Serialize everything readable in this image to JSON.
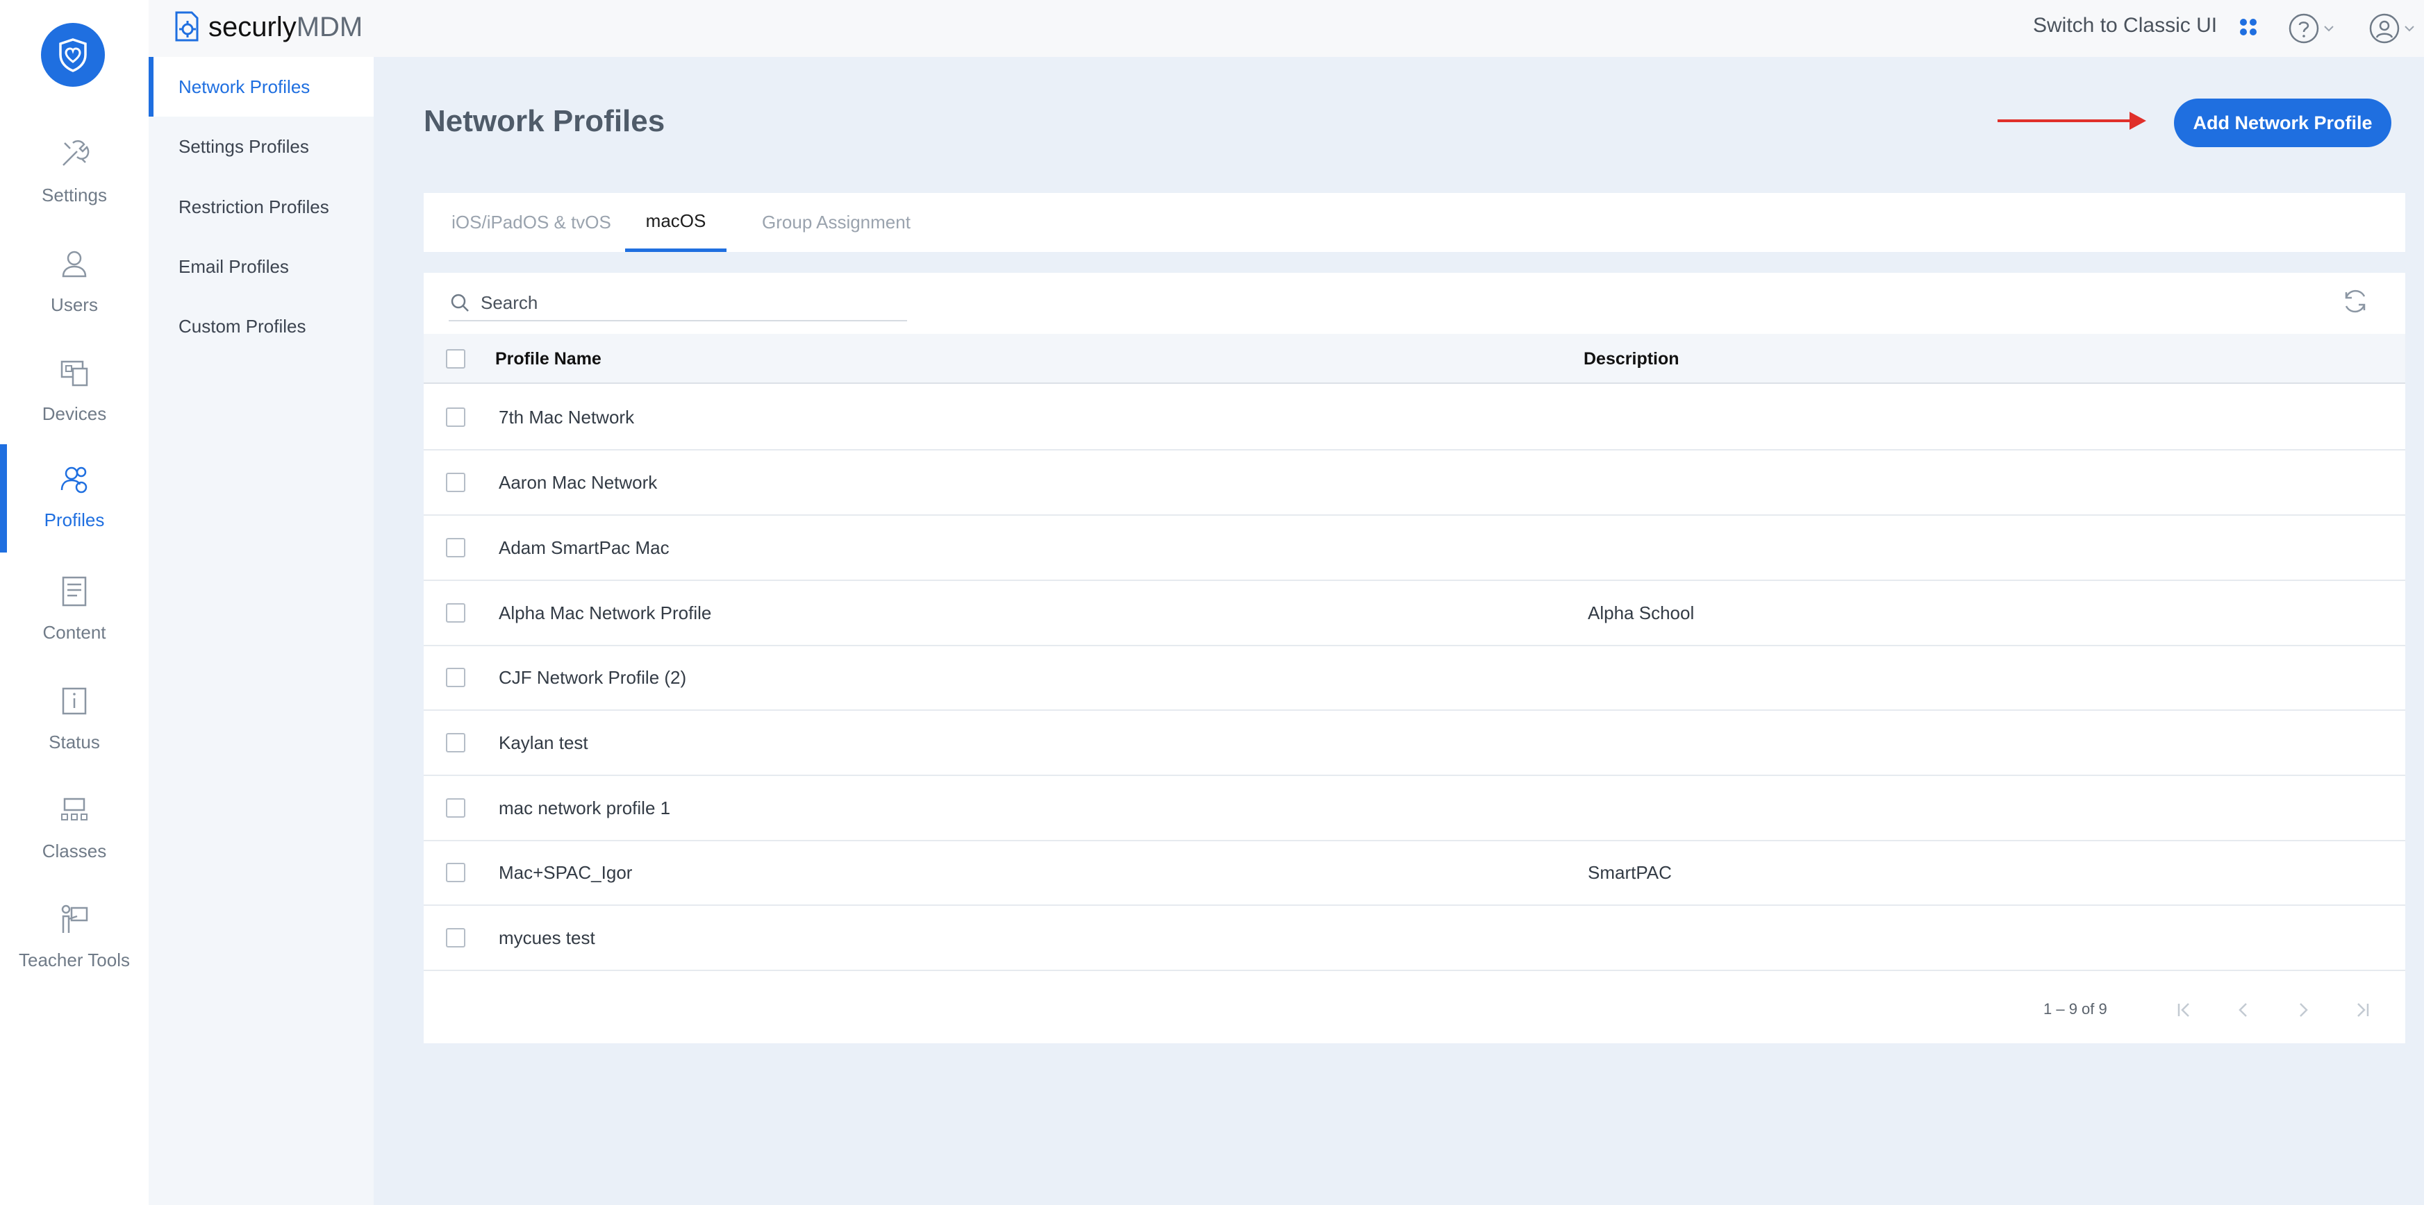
{
  "app": {
    "brand_prefix": "securly",
    "brand_suffix": "MDM"
  },
  "topbar": {
    "switch_classic": "Switch to Classic UI"
  },
  "rail": {
    "items": [
      {
        "label": "Settings",
        "icon": "settings-tools-icon"
      },
      {
        "label": "Users",
        "icon": "user-icon"
      },
      {
        "label": "Devices",
        "icon": "devices-icon"
      },
      {
        "label": "Profiles",
        "icon": "profiles-icon",
        "active": true
      },
      {
        "label": "Content",
        "icon": "content-icon"
      },
      {
        "label": "Status",
        "icon": "status-icon"
      },
      {
        "label": "Classes",
        "icon": "classes-icon"
      },
      {
        "label": "Teacher Tools",
        "icon": "teacher-tools-icon"
      }
    ]
  },
  "subnav": {
    "items": [
      {
        "label": "Network Profiles",
        "active": true
      },
      {
        "label": "Settings Profiles"
      },
      {
        "label": "Restriction Profiles"
      },
      {
        "label": "Email Profiles"
      },
      {
        "label": "Custom Profiles"
      }
    ]
  },
  "main": {
    "title": "Network Profiles",
    "add_button": "Add Network Profile",
    "tabs": [
      {
        "label": "iOS/iPadOS & tvOS"
      },
      {
        "label": "macOS",
        "active": true
      },
      {
        "label": "Group Assignment"
      }
    ],
    "search": {
      "placeholder": "Search"
    },
    "table": {
      "columns": [
        "Profile Name",
        "Description"
      ],
      "rows": [
        {
          "name": "7th Mac Network",
          "description": ""
        },
        {
          "name": "Aaron Mac Network",
          "description": ""
        },
        {
          "name": "Adam SmartPac Mac",
          "description": ""
        },
        {
          "name": "Alpha Mac Network Profile",
          "description": "Alpha School"
        },
        {
          "name": "CJF Network Profile (2)",
          "description": ""
        },
        {
          "name": "Kaylan test",
          "description": ""
        },
        {
          "name": "mac network profile 1",
          "description": ""
        },
        {
          "name": "Mac+SPAC_Igor",
          "description": "SmartPAC"
        },
        {
          "name": "mycues test",
          "description": ""
        }
      ]
    },
    "pagination": {
      "range": "1 – 9 of 9"
    }
  },
  "colors": {
    "accent": "#1f6fe0",
    "annotation_arrow": "#e0302b"
  }
}
